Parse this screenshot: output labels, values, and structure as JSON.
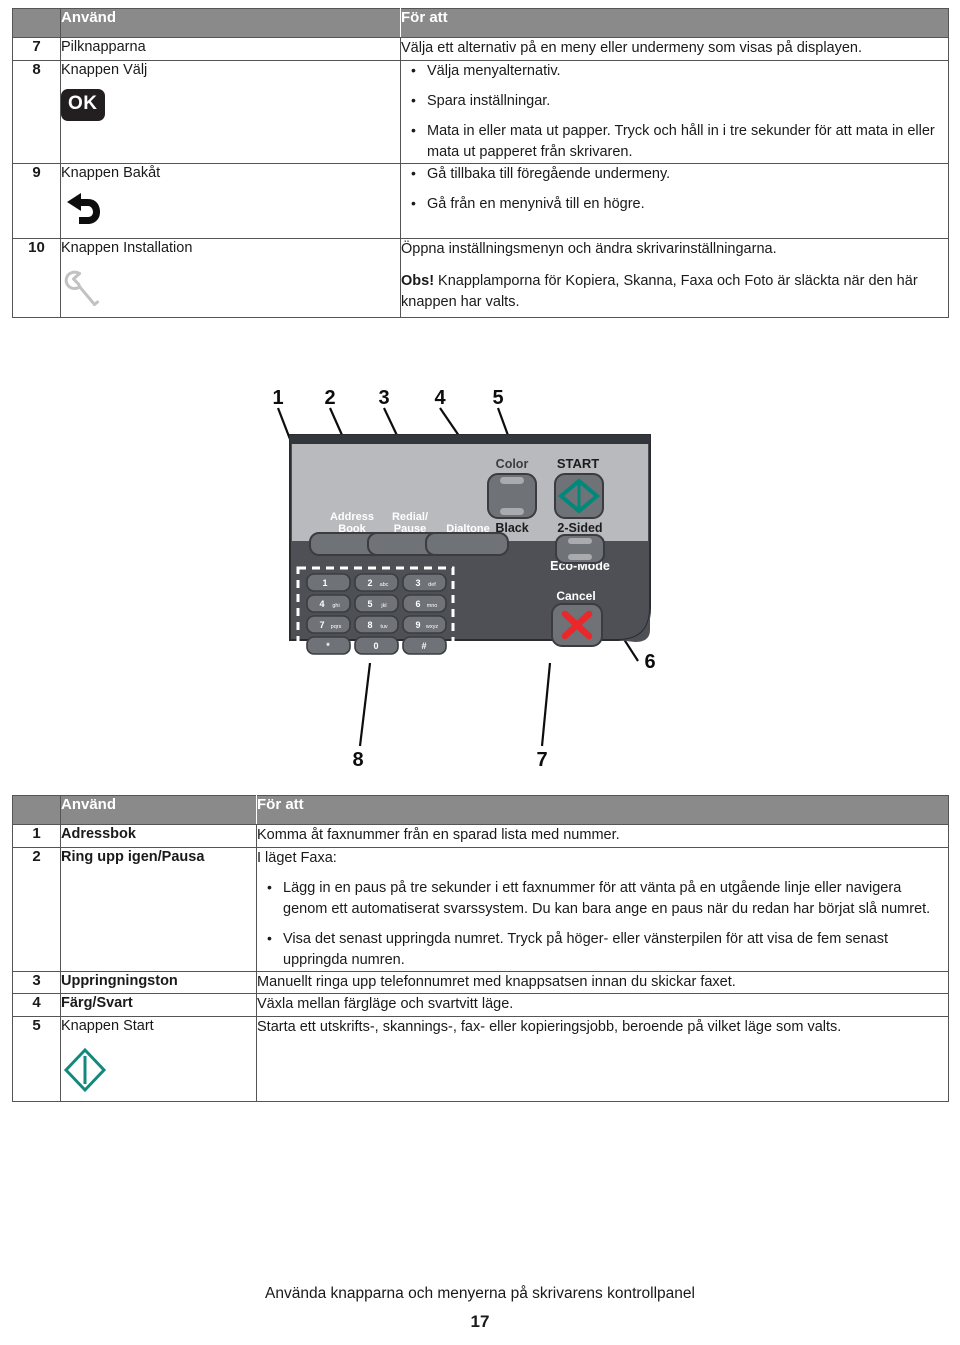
{
  "top_table": {
    "headers": {
      "num": "",
      "use": "Använd",
      "purpose": "För att"
    },
    "rows": [
      {
        "num": "7",
        "name": "Pilknapparna",
        "icon": "",
        "desc_plain": "Välja ett alternativ på en meny eller undermeny som visas på displayen.",
        "bullets": []
      },
      {
        "num": "8",
        "name": "Knappen Välj",
        "icon": "ok-button-icon",
        "icon_label": "OK",
        "desc_plain": "",
        "bullets": [
          "Välja menyalternativ.",
          "Spara inställningar.",
          "Mata in eller mata ut papper. Tryck och håll in i tre sekunder för att mata in eller mata ut papperet från skrivaren."
        ]
      },
      {
        "num": "9",
        "name": "Knappen Bakåt",
        "icon": "back-arrow-icon",
        "desc_plain": "",
        "bullets": [
          "Gå tillbaka till föregående undermeny.",
          "Gå från en menynivå till en högre."
        ]
      },
      {
        "num": "10",
        "name": "Knappen Installation",
        "icon": "wrench-icon",
        "desc_plain": "Öppna inställningsmenyn och ändra skrivarinställningarna.",
        "note_bold": "Obs!",
        "note_text": " Knapplamporna för Kopiera, Skanna, Faxa och Foto är släckta när den här knappen har valts.",
        "bullets": []
      }
    ]
  },
  "panel_figure": {
    "callouts": [
      {
        "id": "1",
        "label": "1"
      },
      {
        "id": "2",
        "label": "2"
      },
      {
        "id": "3",
        "label": "3"
      },
      {
        "id": "4",
        "label": "4"
      },
      {
        "id": "5",
        "label": "5"
      },
      {
        "id": "6",
        "label": "6"
      },
      {
        "id": "7",
        "label": "7"
      },
      {
        "id": "8",
        "label": "8"
      }
    ],
    "button_labels": {
      "address_book": "Address\nBook",
      "address_book_l1": "Address",
      "address_book_l2": "Book",
      "redial_l1": "Redial/",
      "redial_l2": "Pause",
      "dialtone": "Dialtone",
      "color": "Color",
      "black": "Black",
      "start": "START",
      "two_sided": "2-Sided",
      "eco_mode": "Eco-Mode",
      "cancel": "Cancel"
    },
    "keypad": [
      {
        "digit": "1",
        "letters": ""
      },
      {
        "digit": "2",
        "letters": "abc"
      },
      {
        "digit": "3",
        "letters": "def"
      },
      {
        "digit": "4",
        "letters": "ghi"
      },
      {
        "digit": "5",
        "letters": "jkl"
      },
      {
        "digit": "6",
        "letters": "mno"
      },
      {
        "digit": "7",
        "letters": "pqrs"
      },
      {
        "digit": "8",
        "letters": "tuv"
      },
      {
        "digit": "9",
        "letters": "wxyz"
      },
      {
        "digit": "*",
        "letters": ""
      },
      {
        "digit": "0",
        "letters": ""
      },
      {
        "digit": "#",
        "letters": ""
      }
    ],
    "colors": {
      "panel_body": "#4e5055",
      "panel_upper": "#b9babd",
      "panel_top_strip": "#3a3c40",
      "button_face": "#6f7277",
      "start_green": "#00897b",
      "cancel_red": "#e8282b"
    }
  },
  "bottom_table": {
    "headers": {
      "num": "",
      "use": "Använd",
      "purpose": "För att"
    },
    "rows": [
      {
        "num": "1",
        "name": "Adressbok",
        "bold_name": true,
        "desc_plain": "Komma åt faxnummer från en sparad lista med nummer.",
        "bullets": []
      },
      {
        "num": "2",
        "name": "Ring upp igen/Pausa",
        "bold_name": true,
        "desc_plain": "I läget Faxa:",
        "bullets": [
          "Lägg in en paus på tre sekunder i ett faxnummer för att vänta på en utgående linje eller navigera genom ett automatiserat svarssystem. Du kan bara ange en paus när du redan har börjat slå numret.",
          "Visa det senast uppringda numret. Tryck på höger- eller vänsterpilen för att visa de fem senast uppringda numren."
        ]
      },
      {
        "num": "3",
        "name": "Uppringningston",
        "bold_name": true,
        "desc_plain": "Manuellt ringa upp telefonnumret med knappsatsen innan du skickar faxet.",
        "bullets": []
      },
      {
        "num": "4",
        "name": "Färg/Svart",
        "bold_name": true,
        "desc_plain": "Växla mellan färgläge och svartvitt läge.",
        "bullets": []
      },
      {
        "num": "5",
        "name": "Knappen Start",
        "bold_name": false,
        "icon": "start-diamond-icon",
        "desc_plain": "Starta ett utskrifts-, skannings-, fax- eller kopieringsjobb, beroende på vilket läge som valts.",
        "bullets": []
      }
    ]
  },
  "footer": {
    "title": "Använda knapparna och menyerna på skrivarens kontrollpanel",
    "page_number": "17"
  }
}
